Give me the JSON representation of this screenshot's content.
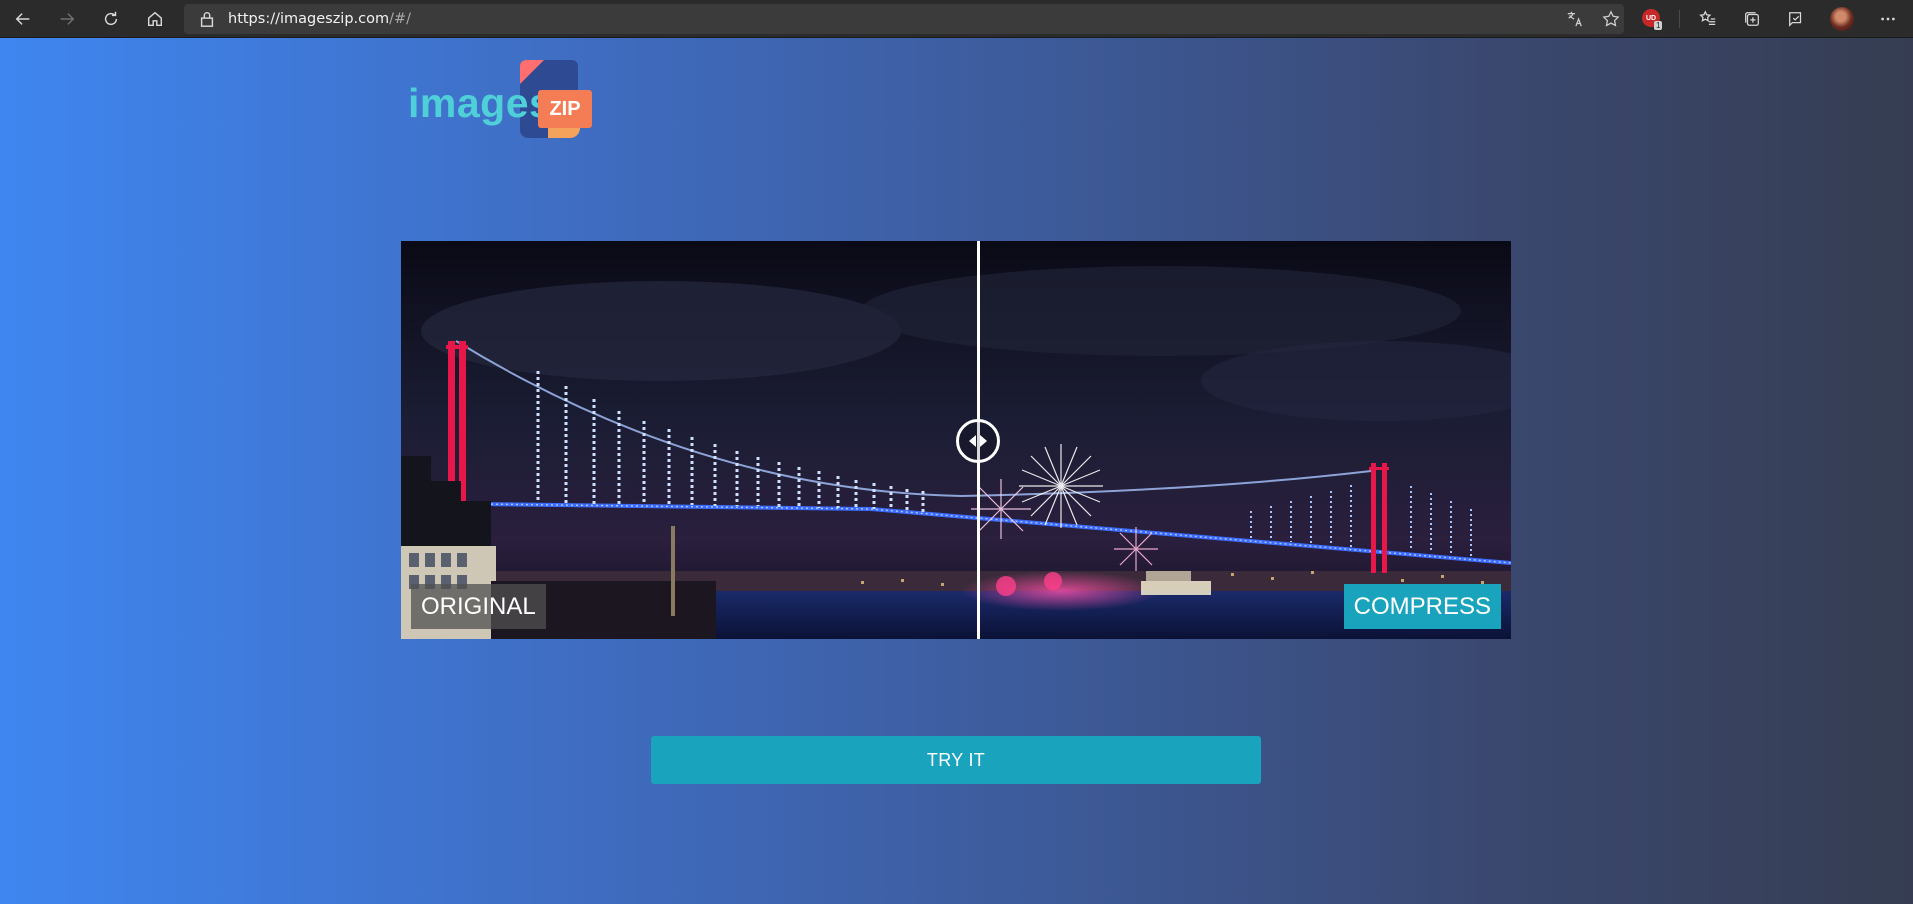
{
  "browser": {
    "url_main": "https://imageszip.com",
    "url_rest": "/#/",
    "extension_badge": "UD",
    "extension_count": "1",
    "icons": [
      "back-icon",
      "forward-icon",
      "refresh-icon",
      "home-icon",
      "lock-icon",
      "translate-icon",
      "favorite-star-icon",
      "ublock-icon",
      "favorites-list-icon",
      "collections-icon",
      "feedback-icon",
      "profile-avatar",
      "more-icon"
    ]
  },
  "site": {
    "logo_text": "images",
    "logo_badge": "ZIP",
    "compare": {
      "left_label": "ORIGINAL",
      "right_label": "COMPRESS",
      "slider_position_fraction": 0.52
    },
    "try_button": "TRY IT"
  },
  "colors": {
    "accent": "#1aa3bd",
    "logo_cyan": "#4fd0d8",
    "logo_orange": "#f47d55",
    "bridge_red": "#e8174a",
    "bridge_lights": "#8fb3ff"
  }
}
